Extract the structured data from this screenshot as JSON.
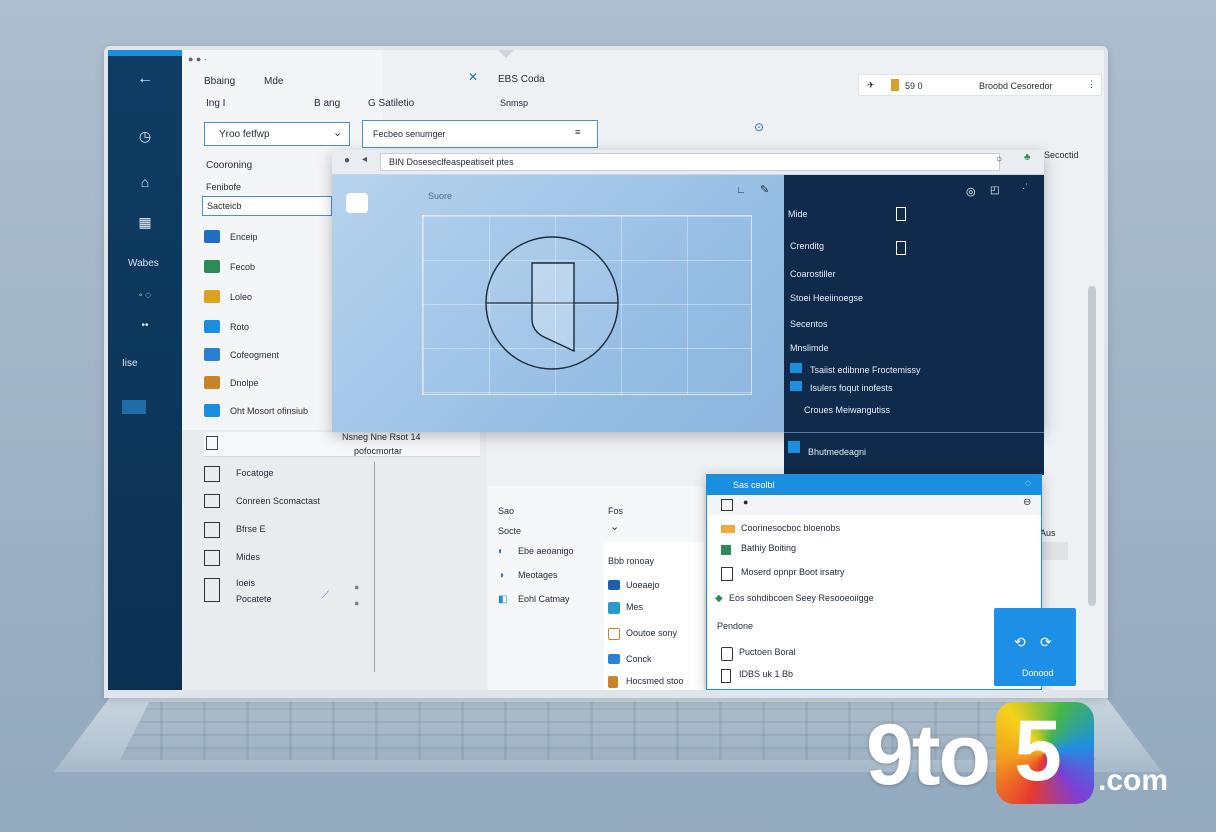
{
  "rail": {
    "items": [
      "Wabes",
      "Iise"
    ]
  },
  "top": {
    "menu1": "Bbaing",
    "menu2": "Mde",
    "row2_a": "Ing I",
    "row2_b": "B ang",
    "row2_c": "G Satiletio",
    "center_title": "EBS Coda",
    "center_sub": "Snmsp",
    "dropdown": "Yroo fetfwp",
    "field": "Fecbeo senumger",
    "search_pill_text": "Broobd Cesoredor",
    "search_pill_num": "59 0",
    "side_label": "Secoctid"
  },
  "sidebar": {
    "heading": "Cooroning",
    "sub": "Fenibofe",
    "input_value": "Sacteicb",
    "items": [
      "Enceip",
      "Fecob",
      "Loleo",
      "Roto",
      "Cofeogment",
      "Dnolpe",
      "Oht Mosort ofinsiub"
    ]
  },
  "window": {
    "address": "BIN Doseseclfeaspeatiseit ptes",
    "canvas_label": "Suore"
  },
  "dark_panel": {
    "items": [
      "Mide",
      "Crenditg",
      "Coarostiller",
      "Stoei Heeiinoegse",
      "Secentos",
      "Mnslimde",
      "Tsaiist edibnne Froctemissy",
      "Isulers foqut inofests",
      "Croues Meiwangutiss",
      "Bhutmedeagni"
    ]
  },
  "lower": {
    "header1": "Nsneg Nne Rsot 14",
    "header2": "pofocmortar",
    "items": [
      "Focatoge",
      "Conreen Scomactast",
      "Bfrse E",
      "Mides",
      "Ioeis",
      "Pocatete"
    ]
  },
  "mid": {
    "label1": "Sao",
    "label2": "Fos",
    "select": "Socte",
    "items": [
      "Ebe aeoanigo",
      "Meotages",
      "Eohl Catmay"
    ]
  },
  "listb": {
    "heading": "Bbb ronoay",
    "items": [
      "Uoeaejo",
      "Mes",
      "Ooutoe sony",
      "Conck",
      "Hocsmed stoo"
    ]
  },
  "dialog": {
    "title": "Sas ceolbl",
    "items": [
      "Coorinesocboc bloenobs",
      "Bathiy Boiting",
      "Moserd opnpr Boot irsatry",
      "Eos sohdibcoen Seey Resooeoiigge",
      "Pendone",
      "Puctoen Boral",
      "IDBS uk 1 Bb"
    ],
    "tile_label": "Donood"
  },
  "right": {
    "label": "Aus"
  },
  "watermark": {
    "prefix": "9to",
    "digit": "5",
    "domain": ".com"
  },
  "colors": {
    "accent": "#1a8fe0",
    "rail": "#0e3d63",
    "dark_panel": "#0f2a4a"
  }
}
